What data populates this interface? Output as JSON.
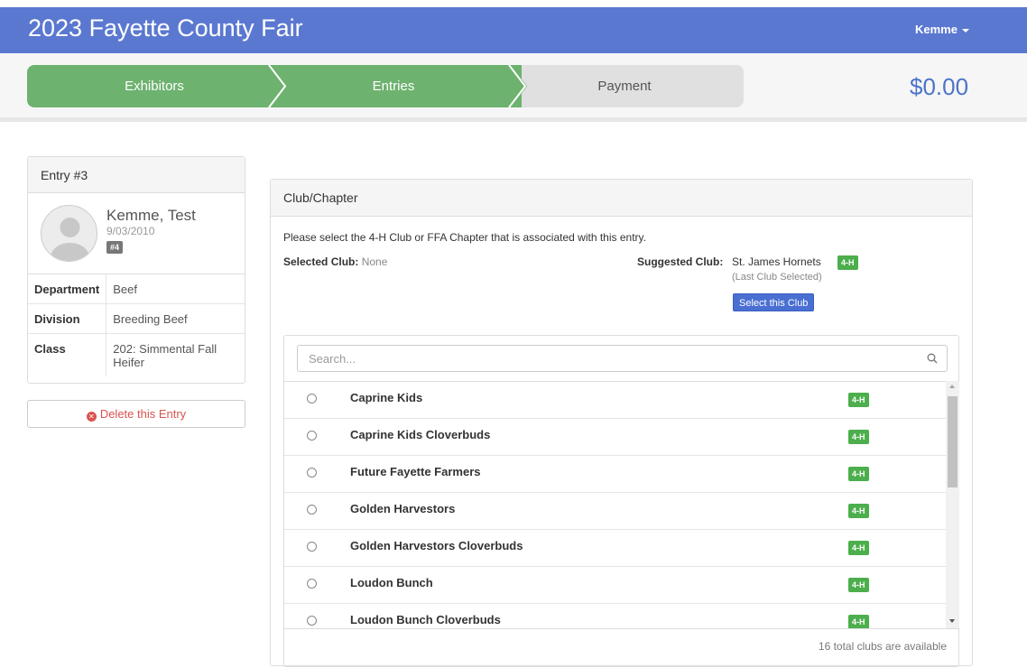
{
  "app": {
    "title": "2023 Fayette County Fair",
    "user": "Kemme"
  },
  "steps": [
    {
      "label": "Exhibitors",
      "state": "complete"
    },
    {
      "label": "Entries",
      "state": "active"
    },
    {
      "label": "Payment",
      "state": "pending"
    }
  ],
  "cart_total": "$0.00",
  "entry": {
    "heading": "Entry #3",
    "exhibitor_name": "Kemme, Test",
    "dob": "9/03/2010",
    "exhibitor_badge": "#4",
    "details": [
      {
        "label": "Department",
        "value": "Beef"
      },
      {
        "label": "Division",
        "value": "Breeding Beef"
      },
      {
        "label": "Class",
        "value": "202: Simmental Fall Heifer"
      }
    ],
    "delete_label": "Delete this Entry"
  },
  "club": {
    "heading": "Club/Chapter",
    "instructions": "Please select the 4-H Club or FFA Chapter that is associated with this entry.",
    "selected_label": "Selected Club:",
    "selected_value": "None",
    "suggested_label": "Suggested Club:",
    "suggested_value": "St. James Hornets",
    "suggested_tag": "4-H",
    "suggested_note": "(Last Club Selected)",
    "select_button": "Select this Club",
    "search_placeholder": "Search...",
    "items": [
      {
        "name": "Caprine Kids",
        "tag": "4-H"
      },
      {
        "name": "Caprine Kids Cloverbuds",
        "tag": "4-H"
      },
      {
        "name": "Future Fayette Farmers",
        "tag": "4-H"
      },
      {
        "name": "Golden Harvestors",
        "tag": "4-H"
      },
      {
        "name": "Golden Harvestors Cloverbuds",
        "tag": "4-H"
      },
      {
        "name": "Loudon Bunch",
        "tag": "4-H"
      },
      {
        "name": "Loudon Bunch Cloverbuds",
        "tag": "4-H"
      }
    ],
    "total_text": "16 total clubs are available"
  },
  "colors": {
    "navbar": "#5b78d1",
    "step_complete": "#6db26f",
    "step_pending": "#e0e0e0",
    "tag_4h": "#4cae4c",
    "danger": "#d9534f"
  }
}
